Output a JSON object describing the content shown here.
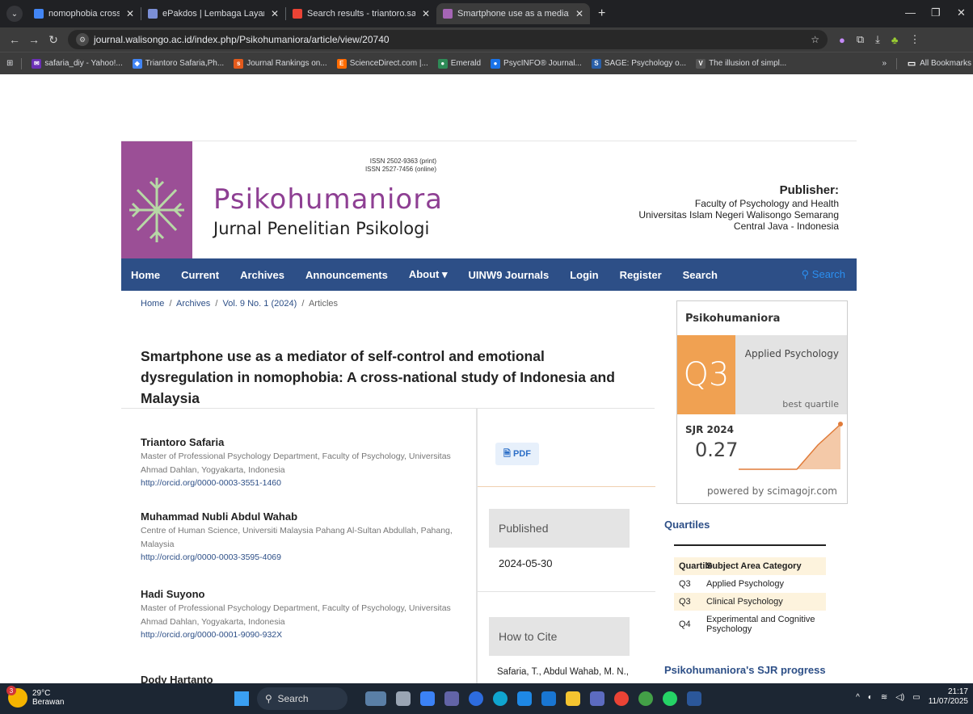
{
  "browser": {
    "tabs": [
      {
        "title": "nomophobia cross national stu",
        "color": "#4285f4",
        "active": false
      },
      {
        "title": "ePakdos | Lembaga Layanan Pe",
        "color": "#7b8fd6",
        "active": false
      },
      {
        "title": "Search results - triantoro.safari",
        "color": "#ea4335",
        "active": false
      },
      {
        "title": "Smartphone use as a mediator",
        "color": "#a565b5",
        "active": true
      }
    ],
    "url": "journal.walisongo.ac.id/index.php/Psikohumaniora/article/view/20740",
    "bookmarks": [
      {
        "label": "safaria_diy - Yahoo!...",
        "color": "#6b2fb5",
        "icon": "✉"
      },
      {
        "label": "Triantoro Safaria,Ph...",
        "color": "#4285f4",
        "icon": "◆"
      },
      {
        "label": "Journal Rankings on...",
        "color": "#e35a1c",
        "icon": "sjr"
      },
      {
        "label": "ScienceDirect.com |...",
        "color": "#ff6c00",
        "icon": "E"
      },
      {
        "label": "Emerald",
        "color": "#2e8b57",
        "icon": "●"
      },
      {
        "label": "PsycINFO® Journal...",
        "color": "#1a73e8",
        "icon": "●"
      },
      {
        "label": "SAGE: Psychology o...",
        "color": "#2a5fa8",
        "icon": "S"
      },
      {
        "label": "The illusion of simpl...",
        "color": "#555",
        "icon": "V"
      }
    ],
    "all_bookmarks": "All Bookmarks"
  },
  "header": {
    "issn_print": "ISSN 2502-9363 (print)",
    "issn_online": "ISSN 2527-7456 (online)",
    "logo_title": "Psikohumaniora",
    "logo_subtitle": "Jurnal Penelitian Psikologi",
    "publisher_label": "Publisher:",
    "publisher_lines": [
      "Faculty of Psychology and Health",
      "Universitas Islam Negeri Walisongo Semarang",
      "Central Java - Indonesia"
    ]
  },
  "nav": {
    "items": [
      "Home",
      "Current",
      "Archives",
      "Announcements",
      "About ▾",
      "UINW9 Journals",
      "Login",
      "Register",
      "Search"
    ],
    "search_link": "Search"
  },
  "breadcrumb": {
    "home": "Home",
    "archives": "Archives",
    "issue": "Vol. 9 No. 1 (2024)",
    "current": "Articles"
  },
  "article": {
    "title": "Smartphone use as a mediator of self-control and emotional dysregulation in nomophobia: A cross-national study of Indonesia and Malaysia",
    "authors": [
      {
        "name": "Triantoro Safaria",
        "affiliation": "Master of Professional Psychology Department, Faculty of Psychology, Universitas Ahmad Dahlan, Yogyakarta, Indonesia",
        "orcid": "http://orcid.org/0000-0003-3551-1460"
      },
      {
        "name": "Muhammad Nubli Abdul Wahab",
        "affiliation": "Centre of Human Science, Universiti Malaysia Pahang Al-Sultan Abdullah, Pahang, Malaysia",
        "orcid": "http://orcid.org/0000-0003-3595-4069"
      },
      {
        "name": "Hadi Suyono",
        "affiliation": "Master of Professional Psychology Department, Faculty of Psychology, Universitas Ahmad Dahlan, Yogyakarta, Indonesia",
        "orcid": "http://orcid.org/0000-0001-9090-932X"
      },
      {
        "name": "Dody Hartanto",
        "affiliation": "",
        "orcid": ""
      }
    ],
    "pdf_label": "PDF",
    "published_label": "Published",
    "published_date": "2024-05-30",
    "cite_label": "How to Cite",
    "cite_text": "Safaria, T., Abdul Wahab, M. N.,"
  },
  "scimago": {
    "journal": "Psikohumaniora",
    "quartile": "Q3",
    "area": "Applied Psychology",
    "best": "best quartile",
    "sjr_label": "SJR 2024",
    "sjr_value": "0.27",
    "powered": "powered by scimagojr.com",
    "accent": "#f0a152"
  },
  "quartiles": {
    "heading": "Quartiles",
    "col1": "Quartile",
    "col2": "Subject Area Category",
    "rows": [
      {
        "q": "Q3",
        "area": "Applied Psychology"
      },
      {
        "q": "Q3",
        "area": "Clinical Psychology"
      },
      {
        "q": "Q4",
        "area": "Experimental and Cognitive Psychology"
      }
    ],
    "progress_heading": "Psikohumaniora's SJR progress"
  },
  "taskbar": {
    "temp": "29°C",
    "weather": "Berawan",
    "badge": "3",
    "search": "Search",
    "time": "21:17",
    "date": "11/07/2025"
  }
}
